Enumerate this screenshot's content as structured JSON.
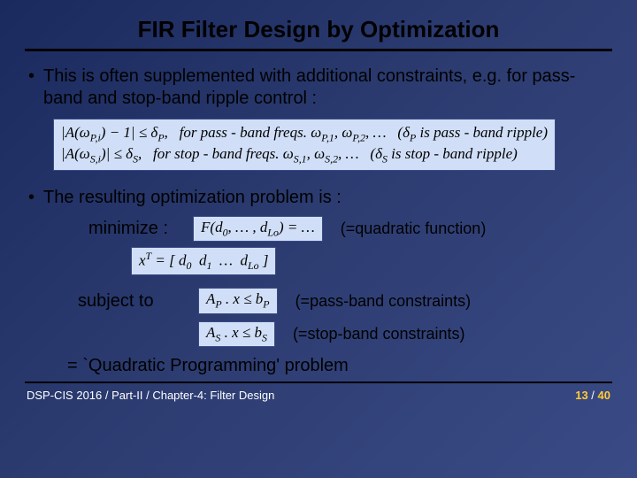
{
  "title": "FIR Filter Design by Optimization",
  "bullets": {
    "b1": "This is often supplemented with additional constraints, e.g. for pass-band and stop-band ripple control :",
    "b2": "The resulting optimization problem is :"
  },
  "eq": {
    "constraint_pass": "|A(ωP,i) − 1| ≤ δP,   for pass-band freqs. ωP,1, ωP,2, …   (δP is pass-band ripple)",
    "constraint_stop": "|A(ωS,i)| ≤ δS,   for stop-band freqs. ωS,1, ωS,2, …   (δS is stop-band ripple)",
    "minimize_label": "minimize :",
    "objective": "F(d0, …, dLo) = …",
    "objective_annot": "(=quadratic function)",
    "xvec": "xᵀ = [ d0  d1  …  dLo ]",
    "subject_label": "subject to",
    "pass_constraint": "AP . x ≤ bP",
    "pass_annot": "(=pass-band constraints)",
    "stop_constraint": "AS . x ≤ bS",
    "stop_annot": "(=stop-band constraints)",
    "qp": "=  `Quadratic Programming' problem"
  },
  "footer": {
    "left": "DSP-CIS 2016 / Part-II / Chapter-4: Filter Design",
    "page_current": "13",
    "page_sep": " / ",
    "page_total": "40"
  }
}
